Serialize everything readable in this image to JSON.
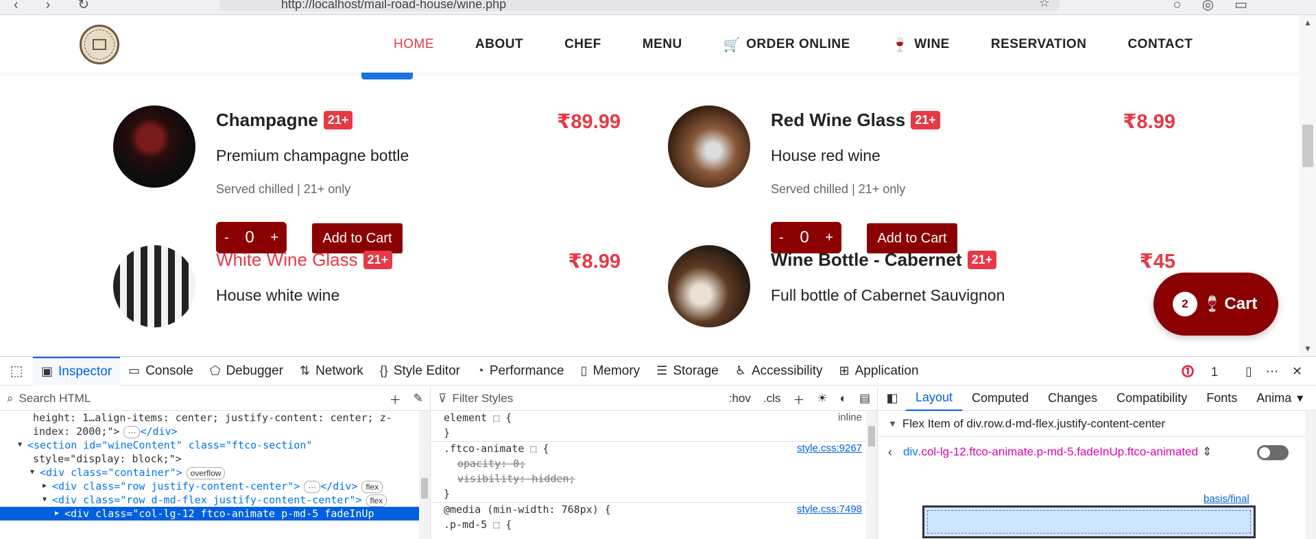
{
  "browser": {
    "url": "http://localhost/mail-road-house/wine.php"
  },
  "nav": {
    "items": [
      {
        "label": "HOME",
        "active": true,
        "glyph": ""
      },
      {
        "label": "ABOUT",
        "active": false,
        "glyph": ""
      },
      {
        "label": "CHEF",
        "active": false,
        "glyph": ""
      },
      {
        "label": "MENU",
        "active": false,
        "glyph": ""
      },
      {
        "label": "ORDER ONLINE",
        "active": false,
        "glyph": "🛒"
      },
      {
        "label": "WINE",
        "active": false,
        "glyph": "🍷"
      },
      {
        "label": "RESERVATION",
        "active": false,
        "glyph": ""
      },
      {
        "label": "CONTACT",
        "active": false,
        "glyph": ""
      }
    ]
  },
  "products": [
    {
      "name": "Champagne",
      "badge": "21+",
      "price": "₹89.99",
      "desc": "Premium champagne bottle",
      "note": "Served chilled | 21+ only",
      "qty": "0",
      "minus": "-",
      "plus": "+",
      "add": "Add to Cart",
      "highlight": false
    },
    {
      "name": "Red Wine Glass",
      "badge": "21+",
      "price": "₹8.99",
      "desc": "House red wine",
      "note": "Served chilled | 21+ only",
      "qty": "0",
      "minus": "-",
      "plus": "+",
      "add": "Add to Cart",
      "highlight": false
    },
    {
      "name": "White Wine Glass",
      "badge": "21+",
      "price": "₹8.99",
      "desc": "House white wine",
      "note": "",
      "qty": "",
      "minus": "",
      "plus": "",
      "add": "",
      "highlight": true
    },
    {
      "name": "Wine Bottle - Cabernet",
      "badge": "21+",
      "price": "₹45",
      "desc": "Full bottle of Cabernet Sauvignon",
      "note": "",
      "qty": "",
      "minus": "",
      "plus": "",
      "add": "",
      "highlight": false
    }
  ],
  "cart": {
    "count": "2",
    "glyph": "🍷",
    "label": "Cart"
  },
  "devtools": {
    "tabs": [
      {
        "label": "Inspector",
        "icon": "▣",
        "active": true
      },
      {
        "label": "Console",
        "icon": "▭",
        "active": false
      },
      {
        "label": "Debugger",
        "icon": "⬠",
        "active": false
      },
      {
        "label": "Network",
        "icon": "⇅",
        "active": false
      },
      {
        "label": "Style Editor",
        "icon": "{}",
        "active": false
      },
      {
        "label": "Performance",
        "icon": "◔",
        "active": false
      },
      {
        "label": "Memory",
        "icon": "▯",
        "active": false
      },
      {
        "label": "Storage",
        "icon": "☰",
        "active": false
      },
      {
        "label": "Accessibility",
        "icon": "♿",
        "active": false
      },
      {
        "label": "Application",
        "icon": "⊞",
        "active": false
      }
    ],
    "error_count": "1",
    "search_placeholder": "Search HTML",
    "filter_placeholder": "Filter Styles",
    "hov": ":hov",
    "cls": ".cls",
    "html_lines": [
      {
        "indent": 48,
        "text": "height: 1…align-items: center; justify-content: center; z-",
        "kind": "text",
        "toggle": "",
        "pill": "",
        "sel": false
      },
      {
        "indent": 48,
        "text": "index: 2000;\">",
        "kind": "text",
        "toggle": "",
        "pill": "···",
        "tail": "</div>",
        "sel": false
      },
      {
        "indent": 40,
        "text": "<section id=\"wineContent\" class=\"ftco-section\"",
        "kind": "tag",
        "toggle": "▼",
        "pill": "",
        "sel": false
      },
      {
        "indent": 48,
        "text": "style=\"display: block;\">",
        "kind": "text",
        "toggle": "",
        "pill": "",
        "sel": false
      },
      {
        "indent": 58,
        "text": "<div class=\"container\">",
        "kind": "tag",
        "toggle": "▼",
        "pill": "overflow",
        "sel": false
      },
      {
        "indent": 76,
        "text": "<div class=\"row justify-content-center\">",
        "kind": "tag",
        "toggle": "▶",
        "pill": "···",
        "tail": "</div>",
        "pill2": "flex",
        "sel": false
      },
      {
        "indent": 76,
        "text": "<div class=\"row d-md-flex justify-content-center\">",
        "kind": "tag",
        "toggle": "▼",
        "pill": "flex",
        "sel": false
      },
      {
        "indent": 94,
        "text": "<div class=\"col-lg-12 ftco-animate p-md-5 fadeInUp",
        "kind": "tag",
        "toggle": "▶",
        "pill": "",
        "sel": true
      }
    ],
    "css_rules": [
      {
        "text": "element ⬚ {",
        "src": "inline",
        "plain": true,
        "strike": false
      },
      {
        "text": "}",
        "src": "",
        "plain": false,
        "strike": false,
        "sep": true
      },
      {
        "text": ".ftco-animate ⬚ {",
        "src": "style.css:9267",
        "plain": false,
        "strike": false
      },
      {
        "text": "opacity: 0;",
        "src": "",
        "plain": false,
        "strike": true
      },
      {
        "text": "visibility: hidden;",
        "src": "",
        "plain": false,
        "strike": true
      },
      {
        "text": "}",
        "src": "",
        "plain": false,
        "strike": false,
        "sep": true
      },
      {
        "text": "@media (min-width: 768px) {",
        "src": "style.css:7498",
        "plain": false,
        "strike": false
      },
      {
        "text": " .p-md-5 ⬚ {",
        "src": "",
        "plain": false,
        "strike": false
      }
    ],
    "layout_tabs": [
      {
        "label": "Layout",
        "active": true
      },
      {
        "label": "Computed",
        "active": false
      },
      {
        "label": "Changes",
        "active": false
      },
      {
        "label": "Compatibility",
        "active": false
      },
      {
        "label": "Fonts",
        "active": false
      },
      {
        "label": "Anima",
        "active": false
      }
    ],
    "flex_item_heading": "Flex Item of div.row.d-md-flex.justify-content-center",
    "flex_selector_tag": "div",
    "flex_selector_classes": ".col-lg-12.ftco-animate.p-md-5.fadeInUp.ftco-animated",
    "basis_label": "basis/final"
  }
}
